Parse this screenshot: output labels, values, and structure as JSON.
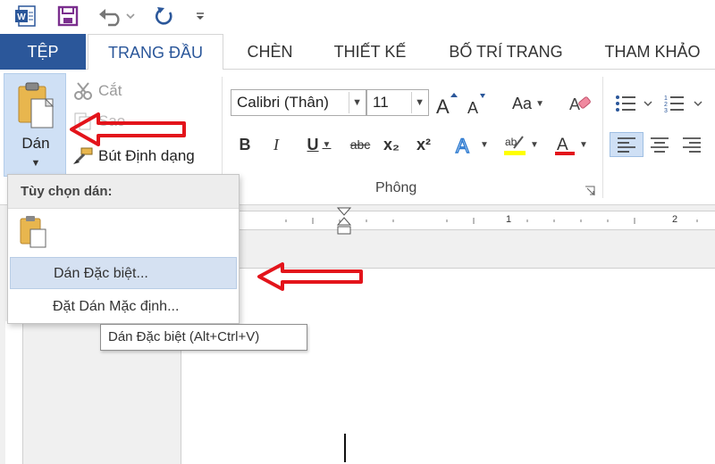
{
  "app": {
    "accent_color": "#2b579a",
    "qat_icons": [
      "word-logo-icon",
      "save-icon",
      "undo-icon",
      "redo-icon",
      "customize-toolbar-icon"
    ]
  },
  "tabs": [
    {
      "id": "file",
      "label": "TỆP"
    },
    {
      "id": "home",
      "label": "TRANG ĐẦU"
    },
    {
      "id": "insert",
      "label": "CHÈN"
    },
    {
      "id": "design",
      "label": "THIẾT KẾ"
    },
    {
      "id": "layout",
      "label": "BỐ TRÍ TRANG"
    },
    {
      "id": "references",
      "label": "THAM KHẢO"
    }
  ],
  "clipboard": {
    "paste_label": "Dán",
    "cut_label": "Cắt",
    "copy_label": "Sao",
    "format_painter_label": "Bút Định dạng"
  },
  "font_group": {
    "font_name": "Calibri (Thân)",
    "font_size": "11",
    "change_case": "Aa",
    "bold": "B",
    "italic": "I",
    "underline": "U",
    "strike": "abc",
    "subscript": "x₂",
    "superscript": "x²",
    "label": "Phông"
  },
  "ruler": {
    "marks": [
      "1",
      "2"
    ]
  },
  "paste_menu": {
    "header": "Tùy chọn dán:",
    "paste_special": "Dán Đặc biệt...",
    "set_default": "Đặt Dán Mặc định..."
  },
  "tooltip": {
    "text": "Dán Đặc biệt (Alt+Ctrl+V)"
  },
  "annotation_color": "#e3141b"
}
